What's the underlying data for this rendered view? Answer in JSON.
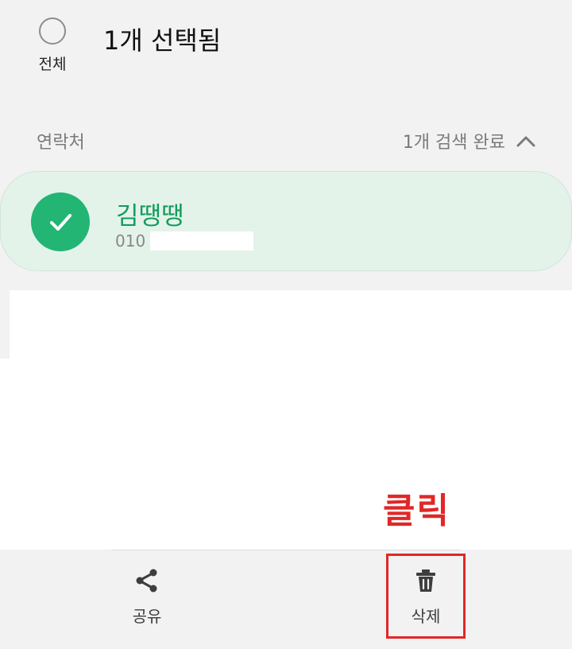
{
  "header": {
    "select_all_label": "전체",
    "selected_count": "1개 선택됨"
  },
  "section": {
    "title": "연락처",
    "result_text": "1개 검색 완료"
  },
  "contact": {
    "name": "김땡땡",
    "phone_prefix": "010",
    "selected": true
  },
  "annotation": {
    "click_label": "클릭",
    "highlight_color": "#e12727"
  },
  "actions": [
    {
      "label": "공유",
      "icon": "share-icon"
    },
    {
      "label": "삭제",
      "icon": "trash-icon"
    }
  ],
  "colors": {
    "accent": "#22b574",
    "name_text": "#139c5d",
    "card_background": "#e4f3ea",
    "page_background": "#f2f2f2"
  }
}
